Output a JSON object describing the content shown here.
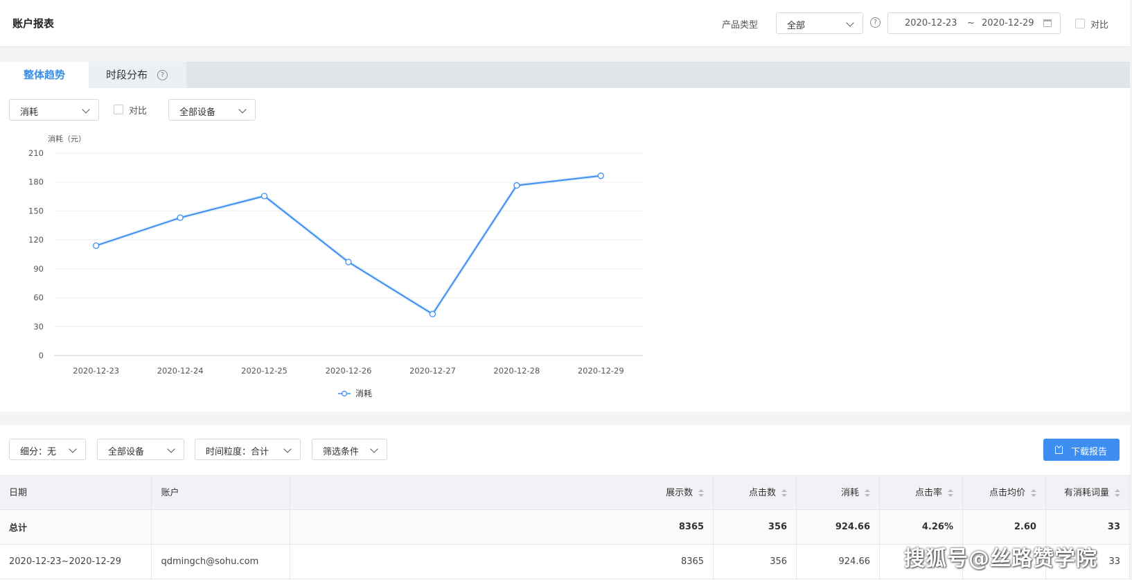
{
  "header": {
    "title": "账户报表",
    "product_type_label": "产品类型",
    "product_type_value": "全部",
    "date_start": "2020-12-23",
    "date_sep": "~",
    "date_end": "2020-12-29",
    "compare_label": "对比"
  },
  "tabs": [
    {
      "label": "整体趋势",
      "active": true
    },
    {
      "label": "时段分布",
      "active": false
    }
  ],
  "chart_toolbar": {
    "metric_value": "消耗",
    "compare_label": "对比",
    "device_value": "全部设备"
  },
  "chart_data": {
    "type": "line",
    "title": "",
    "ylabel": "消耗（元）",
    "xlabel": "",
    "categories": [
      "2020-12-23",
      "2020-12-24",
      "2020-12-25",
      "2020-12-26",
      "2020-12-27",
      "2020-12-28",
      "2020-12-29"
    ],
    "series": [
      {
        "name": "消耗",
        "values": [
          114,
          143,
          165.5,
          97,
          43,
          176.5,
          186.5
        ]
      }
    ],
    "ylim": [
      0,
      210
    ],
    "yticks": [
      0,
      30,
      60,
      90,
      120,
      150,
      180,
      210
    ],
    "grid": true,
    "legend": "bottom-center",
    "color": "#3d8ef0"
  },
  "table_toolbar": {
    "breakdown": "细分：无",
    "device": "全部设备",
    "granularity": "时间粒度：合计",
    "filter": "筛选条件",
    "download": "下载报告"
  },
  "table": {
    "columns": [
      "日期",
      "账户",
      "展示数",
      "点击数",
      "消耗",
      "点击率",
      "点击均价",
      "有消耗词量"
    ],
    "total": [
      "总计",
      "",
      "8365",
      "356",
      "924.66",
      "4.26%",
      "2.60",
      "33"
    ],
    "rows": [
      [
        "2020-12-23~2020-12-29",
        "qdmingch@sohu.com",
        "8365",
        "356",
        "924.66",
        "",
        "",
        "33"
      ]
    ]
  },
  "watermark": "搜狐号@丝路赞学院",
  "colors": {
    "accent": "#3d8ef0",
    "tab_bar": "#e1e5ea",
    "page_bg": "#f3f4f6"
  }
}
